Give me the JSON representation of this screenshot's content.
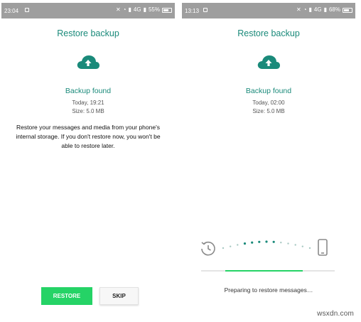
{
  "colors": {
    "accent": "#1a8a7a",
    "restore_green": "#25d366",
    "statusbar": "#9e9e9e"
  },
  "left": {
    "status": {
      "time": "23:04",
      "network": "4G",
      "battery": "55%"
    },
    "title": "Restore backup",
    "cloud_icon": "cloud-upload-icon",
    "backup_found": "Backup found",
    "date": "Today, 19:21",
    "size": "Size: 5.0 MB",
    "description": "Restore your messages and media from your phone's internal storage. If you don't restore now, you won't be able to restore later.",
    "restore_button": "RESTORE",
    "skip_button": "SKIP"
  },
  "right": {
    "status": {
      "time": "13:13",
      "network": "4G",
      "battery": "68%"
    },
    "title": "Restore backup",
    "cloud_icon": "cloud-upload-icon",
    "backup_found": "Backup found",
    "date": "Today, 02:00",
    "size": "Size: 5.0 MB",
    "transfer_icons": [
      "history-icon",
      "phone-icon"
    ],
    "progress": {
      "start": 0.18,
      "end": 0.76
    },
    "preparing": "Preparing to restore messages…"
  },
  "watermark": "wsxdn.com"
}
